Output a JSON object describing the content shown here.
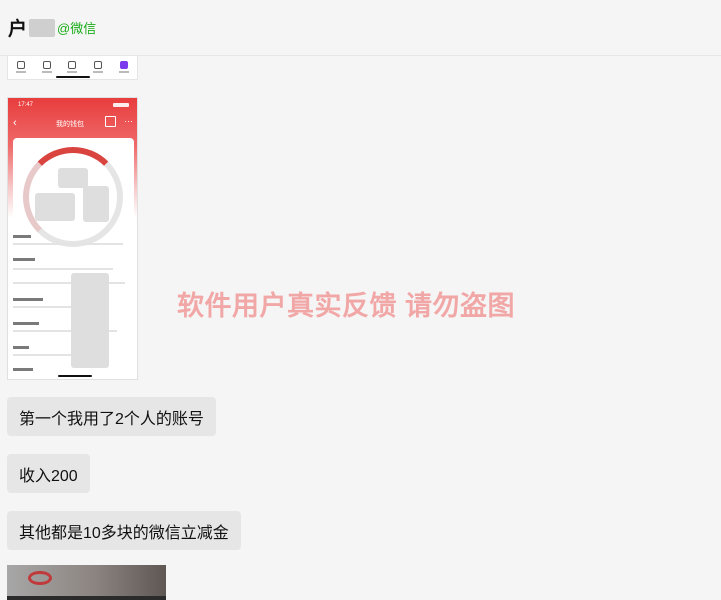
{
  "header": {
    "title": "户",
    "suffix": "@微信"
  },
  "messages": [
    {
      "text": "第一个我用了2个人的账号"
    },
    {
      "text": "收入200"
    },
    {
      "text": "其他都是10多块的微信立减金"
    }
  ],
  "watermark": "软件用户真实反馈  请勿盗图",
  "shared_screenshot": {
    "time": "17:47",
    "title": "我的钱包"
  },
  "colors": {
    "wechat_green": "#1aad19",
    "watermark": "#f2a7a7",
    "bubble": "#e6e6e6"
  },
  "icons": [
    "back-icon",
    "calendar-icon",
    "more-icon"
  ]
}
